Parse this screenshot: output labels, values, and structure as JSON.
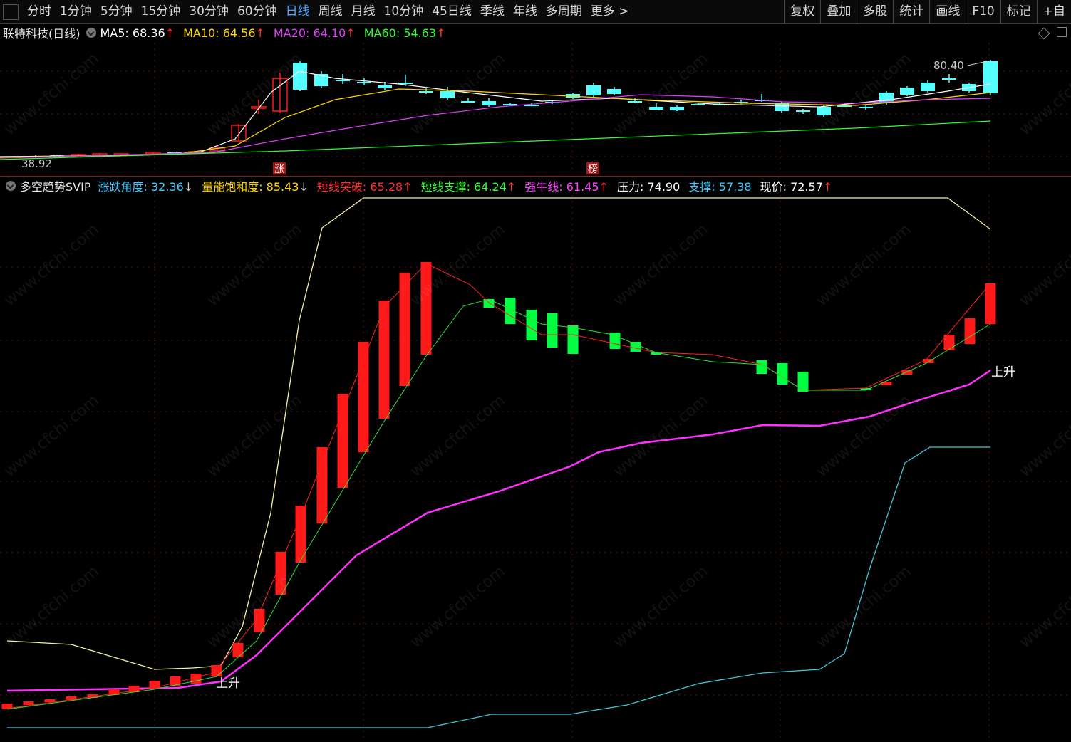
{
  "toolbar": {
    "periods": [
      "分时",
      "1分钟",
      "5分钟",
      "15分钟",
      "30分钟",
      "60分钟",
      "日线",
      "周线",
      "月线",
      "10分钟",
      "45日线",
      "季线",
      "年线",
      "多周期",
      "更多 >"
    ],
    "active_period": "日线",
    "tools": [
      "复权",
      "叠加",
      "多股",
      "统计",
      "画线",
      "F10",
      "标记",
      "+自"
    ]
  },
  "main_panel": {
    "stock_name": "联特科技(日线)",
    "indicators": [
      {
        "label": "MA5: 68.36",
        "arrow": "↑",
        "color": "#ffffff"
      },
      {
        "label": "MA10: 64.56",
        "arrow": "↑",
        "color": "#ffd700"
      },
      {
        "label": "MA20: 64.10",
        "arrow": "↑",
        "color": "#e040fb"
      },
      {
        "label": "MA60: 54.63",
        "arrow": "↑",
        "color": "#30ff30"
      }
    ],
    "high_label": "80.40",
    "low_label": "38.92",
    "markers": [
      "涨",
      "榜"
    ]
  },
  "sub_panel": {
    "name": "多空趋势SVIP",
    "indicators": [
      {
        "label": "涨跌角度: 32.36",
        "arrow": "↓",
        "color": "#40c8ff"
      },
      {
        "label": "量能饱和度: 85.43",
        "arrow": "↓",
        "color": "#ffd700"
      },
      {
        "label": "短线突破: 65.28",
        "arrow": "↑",
        "color": "#ff3030"
      },
      {
        "label": "短线支撑: 64.24",
        "arrow": "↑",
        "color": "#30ff30"
      },
      {
        "label": "强牛线: 61.45",
        "arrow": "↑",
        "color": "#ff40ff"
      },
      {
        "label": "压力: 74.90",
        "arrow": "",
        "color": "#ffffff"
      },
      {
        "label": "支撑: 57.38",
        "arrow": "",
        "color": "#40c8ff"
      },
      {
        "label": "现价: 72.57",
        "arrow": "↑",
        "color": "#ffffff"
      }
    ],
    "signals": [
      "上升",
      "上升"
    ]
  },
  "watermark": "www.cfchi.com",
  "colors": {
    "up": "#ff1a1a",
    "down": "#00ff40",
    "down_main": "#54ffff",
    "grid": "#5a1010"
  }
}
